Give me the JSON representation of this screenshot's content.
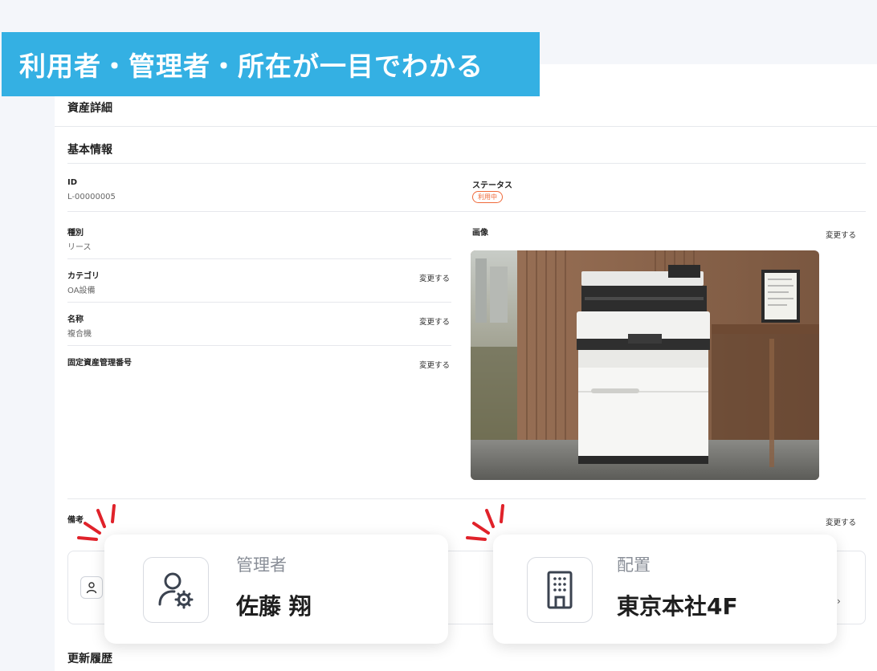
{
  "banner": {
    "text": "利用者・管理者・所在が一目でわかる"
  },
  "page": {
    "title": "資産詳細"
  },
  "basic_info": {
    "title": "基本情報",
    "id": {
      "label": "ID",
      "value": "L-00000005"
    },
    "status": {
      "label": "ステータス",
      "badge": "利用中",
      "badge_color": "#ef6a3a"
    },
    "type": {
      "label": "種別",
      "value": "リース"
    },
    "category": {
      "label": "カテゴリ",
      "value": "OA設備",
      "action": "変更する"
    },
    "name": {
      "label": "名称",
      "value": "複合機",
      "action": "変更する"
    },
    "asset_number": {
      "label": "固定資産管理番号",
      "value": "",
      "action": "変更する"
    },
    "image": {
      "label": "画像",
      "action": "変更する"
    }
  },
  "notes": {
    "label": "備考",
    "action": "変更する"
  },
  "history": {
    "title": "更新履歴"
  },
  "cards": {
    "manager": {
      "caption": "管理者",
      "value": "佐藤 翔",
      "icon": "user-gear-icon"
    },
    "location": {
      "caption": "配置",
      "value": "東京本社4F",
      "icon": "building-icon"
    }
  },
  "colors": {
    "banner": "#34b0e3",
    "accent_spark": "#e0222a"
  }
}
